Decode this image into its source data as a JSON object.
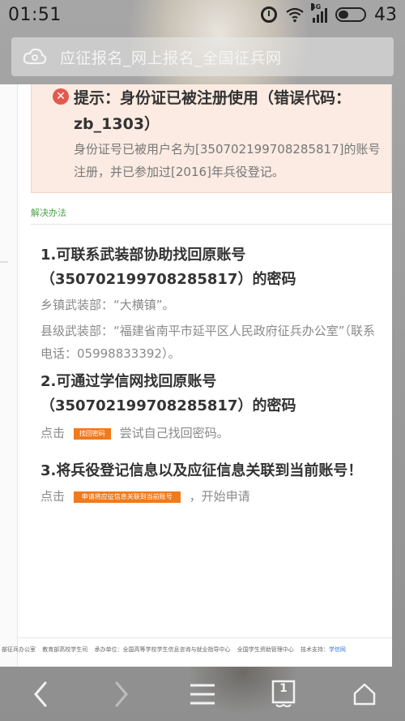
{
  "status_bar": {
    "time": "01:51",
    "network": "4G",
    "battery": "43",
    "icons": [
      "alarm-icon",
      "wifi-icon",
      "signal-icon",
      "battery-icon"
    ]
  },
  "url_bar": {
    "title": "应征报名_网上报名_全国征兵网",
    "icon": "cloud-logo-icon"
  },
  "alert": {
    "title": "提示：身份证已被注册使用（错误代码：zb_1303）",
    "description": "身份证号已被用户名为[35070219970828581​7]的账号注册，并已参加过[2016]年兵役登记。",
    "color": "#e35a4d"
  },
  "solution": {
    "label": "解决办法",
    "steps": [
      {
        "title": "1.可联系武装部协助找回原账号（35070219970828581​7）的密码",
        "lines": [
          "乡镇武装部：“大横镇”。",
          "县级武装部：“福建省南平市延平区人民政府征兵办公室”（联系电话：05998833392）。"
        ]
      },
      {
        "title": "2.可通过学信网找回原账号（35070219970828581​7）的密码",
        "prefix": "点击",
        "button": "找回密码",
        "suffix": "尝试自己找回密码。"
      },
      {
        "title": "3.将兵役登记信息以及应征信息关联到当前账号！",
        "prefix": "点击",
        "button": "申请将应征信息关联到当前账号",
        "suffix": "，开始申请"
      }
    ]
  },
  "footer": {
    "org1": "部征兵办公室",
    "org2": "教育部高校学生司",
    "host": "承办单位：全国高等学校学生信息咨询与就业指导中心",
    "org3": "全国学生资助管理中心",
    "tech_label": "技术支持：",
    "tech_link": "学信网"
  },
  "nav": {
    "back": "back-icon",
    "forward": "forward-icon",
    "menu": "menu-icon",
    "tabs_count": "1",
    "home": "home-icon"
  },
  "colors": {
    "accent_orange": "#f07a1c",
    "alert_bg": "#fbebe2",
    "solution_green": "#4aa24a"
  }
}
